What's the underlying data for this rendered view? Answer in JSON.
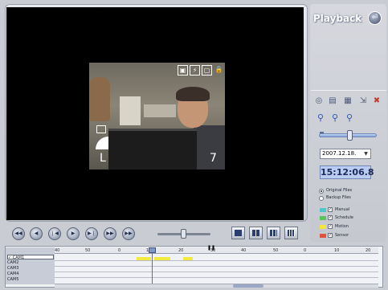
{
  "panel": {
    "title": "Playback",
    "title_icon": "playback-icon",
    "tool_icons": [
      "camera-icon",
      "capture-icon",
      "film-icon",
      "export-icon",
      "close-icon"
    ],
    "zoom_icons": [
      "zoom-in-icon",
      "zoom-out-icon",
      "zoom-reset-icon"
    ],
    "date": "2007.12.18.",
    "time": "15:12:06.8",
    "file_source": {
      "options": [
        "Original Files",
        "Backup Files"
      ],
      "selected": "Original Files"
    },
    "legend": [
      {
        "label": "Manual",
        "color": "#4fc7c9",
        "checked": true
      },
      {
        "label": "Schedule",
        "color": "#57c45c",
        "checked": true
      },
      {
        "label": "Motion",
        "color": "#f2e63a",
        "checked": true
      },
      {
        "label": "Sensor",
        "color": "#e0533f",
        "checked": true
      }
    ]
  },
  "video": {
    "overlay_letter": "L",
    "overlay_number": "7"
  },
  "controls": {
    "buttons": [
      "rewind-fast",
      "rewind",
      "step-back",
      "play",
      "step-forward",
      "forward",
      "forward-fast"
    ],
    "layouts": [
      "single-view",
      "quad-view",
      "nine-view",
      "sixteen-view"
    ]
  },
  "timeline": {
    "cameras": [
      "✓ CAM1",
      "CAM2",
      "CAM3",
      "CAM4",
      "CAM5"
    ],
    "ticks": [
      "40",
      "50",
      "0",
      "10",
      "20",
      "30",
      "40",
      "50",
      "0",
      "10",
      "20"
    ]
  }
}
